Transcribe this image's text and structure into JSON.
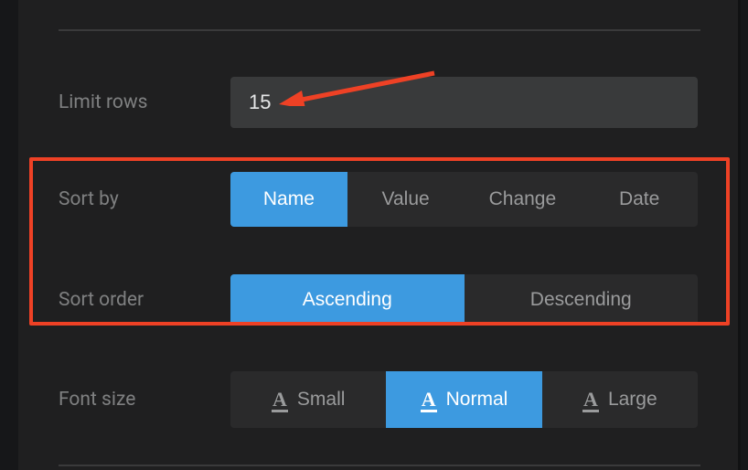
{
  "limit_rows": {
    "label": "Limit rows",
    "value": "15"
  },
  "sort_by": {
    "label": "Sort by",
    "options": [
      {
        "label": "Name",
        "active": true
      },
      {
        "label": "Value",
        "active": false
      },
      {
        "label": "Change",
        "active": false
      },
      {
        "label": "Date",
        "active": false
      }
    ]
  },
  "sort_order": {
    "label": "Sort order",
    "options": [
      {
        "label": "Ascending",
        "active": true
      },
      {
        "label": "Descending",
        "active": false
      }
    ]
  },
  "font_size": {
    "label": "Font size",
    "icon_glyph": "A",
    "options": [
      {
        "label": "Small",
        "active": false
      },
      {
        "label": "Normal",
        "active": true
      },
      {
        "label": "Large",
        "active": false
      }
    ]
  },
  "annotations": {
    "highlight_color": "#ee4125",
    "arrow_color": "#ee4125"
  }
}
